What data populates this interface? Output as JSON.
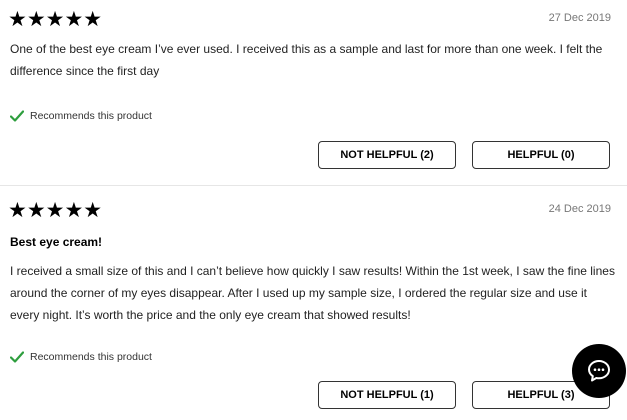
{
  "reviews": [
    {
      "rating": 5,
      "stars": "★★★★★",
      "date": "27 Dec 2019",
      "title": "",
      "body": "One of the best eye cream I’ve ever used. I received this as a sample and last for more than one week. I felt the difference since the first day",
      "recommends": "Recommends this product",
      "not_helpful_label": "NOT HELPFUL (2)",
      "helpful_label": "HELPFUL (0)"
    },
    {
      "rating": 5,
      "stars": "★★★★★",
      "date": "24 Dec 2019",
      "title": "Best eye cream!",
      "body": "I received a small size of this and I can’t believe how quickly I saw results! Within the 1st week, I saw the fine lines around the corner of my eyes disappear. After I used up my sample size, I ordered the regular size and use it every night. It’s worth the price and the only eye cream that showed results!",
      "recommends": "Recommends this product",
      "not_helpful_label": "NOT HELPFUL (1)",
      "helpful_label": "HELPFUL (3)"
    }
  ],
  "colors": {
    "check": "#2e9e3e",
    "chat_button": "#000000"
  },
  "icons": {
    "check": "check-icon",
    "chat": "chat-bubble-icon"
  }
}
